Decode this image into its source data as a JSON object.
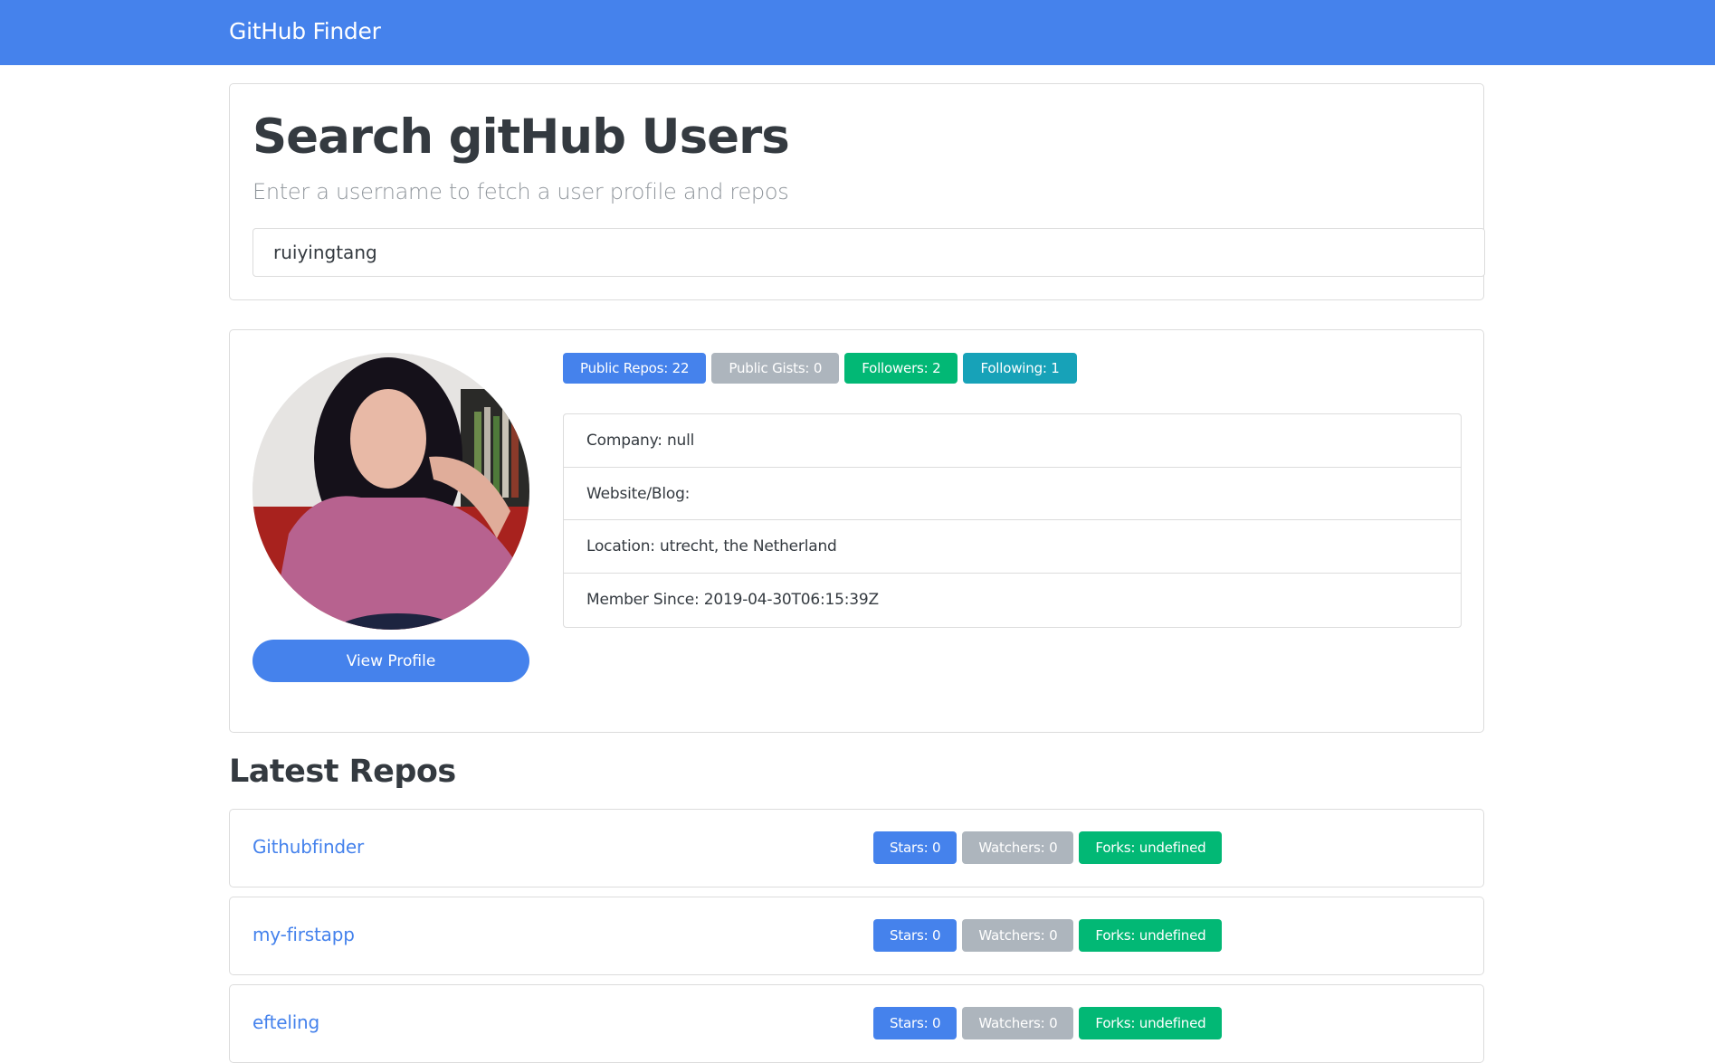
{
  "navbar": {
    "brand": "GitHub Finder",
    "color": "#4582ec"
  },
  "search": {
    "title": "Search gitHub Users",
    "lead": "Enter a username to fetch a user profile and repos",
    "input_value": "ruiyingtang",
    "input_placeholder": ""
  },
  "profile": {
    "avatar_alt": "user avatar photo",
    "view_profile_label": "View Profile",
    "badges": [
      {
        "label": "Public Repos: 22",
        "variant": "primary"
      },
      {
        "label": "Public Gists: 0",
        "variant": "secondary"
      },
      {
        "label": "Followers: 2",
        "variant": "success"
      },
      {
        "label": "Following: 1",
        "variant": "info"
      }
    ],
    "details": [
      "Company: null",
      "Website/Blog:",
      "Location: utrecht, the Netherland",
      "Member Since: 2019-04-30T06:15:39Z"
    ]
  },
  "repos": {
    "title": "Latest Repos",
    "items": [
      {
        "name": "Githubfinder",
        "stars": "Stars: 0",
        "watchers": "Watchers: 0",
        "forks": "Forks: undefined"
      },
      {
        "name": "my-firstapp",
        "stars": "Stars: 0",
        "watchers": "Watchers: 0",
        "forks": "Forks: undefined"
      },
      {
        "name": "efteling",
        "stars": "Stars: 0",
        "watchers": "Watchers: 0",
        "forks": "Forks: undefined"
      }
    ]
  },
  "colors": {
    "primary": "#4582ec",
    "secondary": "#adb5bd",
    "success": "#02b875",
    "info": "#17a2b8",
    "text": "#343a40",
    "muted": "#8f959b"
  }
}
